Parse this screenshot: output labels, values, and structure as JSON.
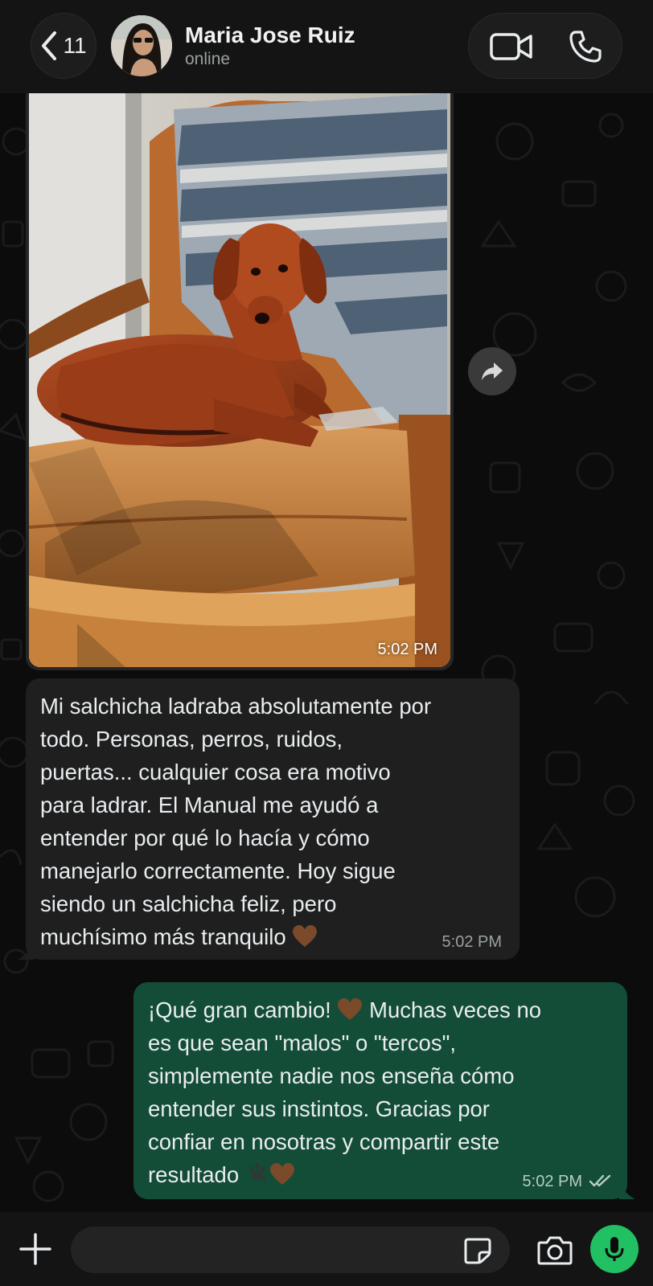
{
  "header": {
    "back_count": "11",
    "contact_name": "Maria Jose Ruiz",
    "status": "online",
    "icons": [
      "chevron-left-icon",
      "video-call-icon",
      "phone-icon"
    ]
  },
  "messages": [
    {
      "type": "image",
      "direction": "incoming",
      "time": "5:02 PM"
    },
    {
      "type": "text",
      "direction": "incoming",
      "lines": [
        "Mi salchicha ladraba absolutamente por",
        "todo. Personas, perros, ruidos,",
        "puertas... cualquier cosa era motivo",
        "para ladrar. El Manual me ayudó a",
        "entender por qué lo hacía y cómo",
        "manejarlo correctamente. Hoy sigue",
        "siendo un salchicha feliz, pero",
        "muchísimo más tranquilo"
      ],
      "emoji_end": "brown-heart",
      "time": "5:02 PM"
    },
    {
      "type": "text",
      "direction": "outgoing",
      "line1_a": "¡Qué gran cambio!",
      "line1_b": "Muchas veces no",
      "lines": [
        "es que sean \"malos\" o \"tercos\",",
        "simplemente nadie nos enseña cómo",
        "entender sus instintos. Gracias por",
        "confiar en nosotras y compartir este"
      ],
      "last_line": "resultado",
      "emoji_end": [
        "paw-prints",
        "brown-heart"
      ],
      "time": "5:02 PM",
      "read_status": "double-check"
    }
  ],
  "composer": {
    "placeholder": "",
    "icons": [
      "plus-icon",
      "sticker-icon",
      "camera-icon",
      "microphone-icon"
    ]
  },
  "colors": {
    "outgoing_bubble": "#134d37",
    "incoming_bubble": "#1f1f1f",
    "mic_button": "#21c063",
    "background": "#0c0c0c"
  }
}
